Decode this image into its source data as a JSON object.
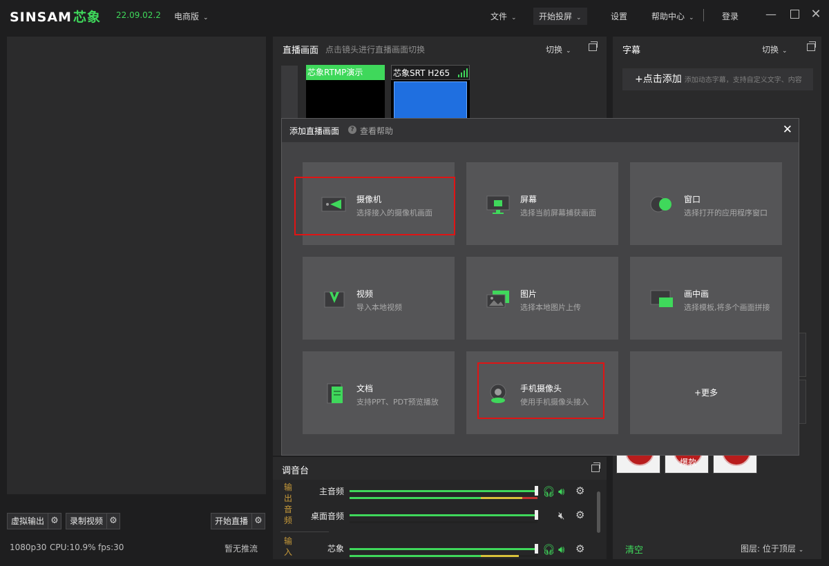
{
  "topbar": {
    "logo_text": "SINSAM",
    "logo_cn": "芯象",
    "version": "22.09.02.2",
    "edition": "电商版",
    "menu_file": "文件",
    "menu_cast": "开始投屏",
    "menu_settings": "设置",
    "menu_help": "帮助中心",
    "menu_login": "登录"
  },
  "left": {
    "virtual_output": "虚拟输出",
    "record_video": "录制视频",
    "start_live": "开始直播",
    "status_resolution": "1080p30",
    "status_cpu": "CPU:10.9%",
    "status_fps": "fps:30",
    "status_push": "暂无推流"
  },
  "live": {
    "title": "直播画面",
    "subtitle": "点击镜头进行直播画面切换",
    "switch": "切换",
    "scenes": [
      {
        "label": "芯象RTMP演示"
      },
      {
        "label": "芯象SRT H265"
      }
    ]
  },
  "subtitle_panel": {
    "title": "字幕",
    "switch": "切换",
    "add": "+点击添加",
    "add_hint": "添加动态字幕，支持自定义文字、内容"
  },
  "assets": {
    "badges": [
      "",
      "爆款",
      ""
    ],
    "clear": "清空",
    "layer_label": "图层:",
    "layer_value": "位于顶层"
  },
  "mixer": {
    "title": "调音台",
    "output_group": [
      "输",
      "出",
      "音",
      "频"
    ],
    "input_group": [
      "输",
      "入"
    ],
    "channels": [
      {
        "name": "主音频",
        "level": 1.0
      },
      {
        "name": "桌面音频",
        "level": 1.0
      },
      {
        "name": "芯象",
        "level": 1.0
      }
    ]
  },
  "dialog": {
    "title": "添加直播画面",
    "help": "查看帮助",
    "tiles": [
      {
        "name": "摄像机",
        "desc": "选择接入的摄像机画面",
        "icon": "camera-icon"
      },
      {
        "name": "屏幕",
        "desc": "选择当前屏幕捕获画面",
        "icon": "monitor-icon"
      },
      {
        "name": "窗口",
        "desc": "选择打开的应用程序窗口",
        "icon": "window-icon"
      },
      {
        "name": "视频",
        "desc": "导入本地视频",
        "icon": "video-icon"
      },
      {
        "name": "图片",
        "desc": "选择本地图片上传",
        "icon": "image-icon"
      },
      {
        "name": "画中画",
        "desc": "选择模板,将多个画面拼接",
        "icon": "pip-icon"
      },
      {
        "name": "文档",
        "desc": "支持PPT、PDT预览播放",
        "icon": "document-icon"
      },
      {
        "name": "手机摄像头",
        "desc": "使用手机摄像头接入",
        "icon": "phone-camera-icon"
      }
    ],
    "more": "+更多"
  },
  "colors": {
    "accent": "#3fd85b",
    "highlight_box": "#e01414",
    "tile_bg": "#555557"
  }
}
